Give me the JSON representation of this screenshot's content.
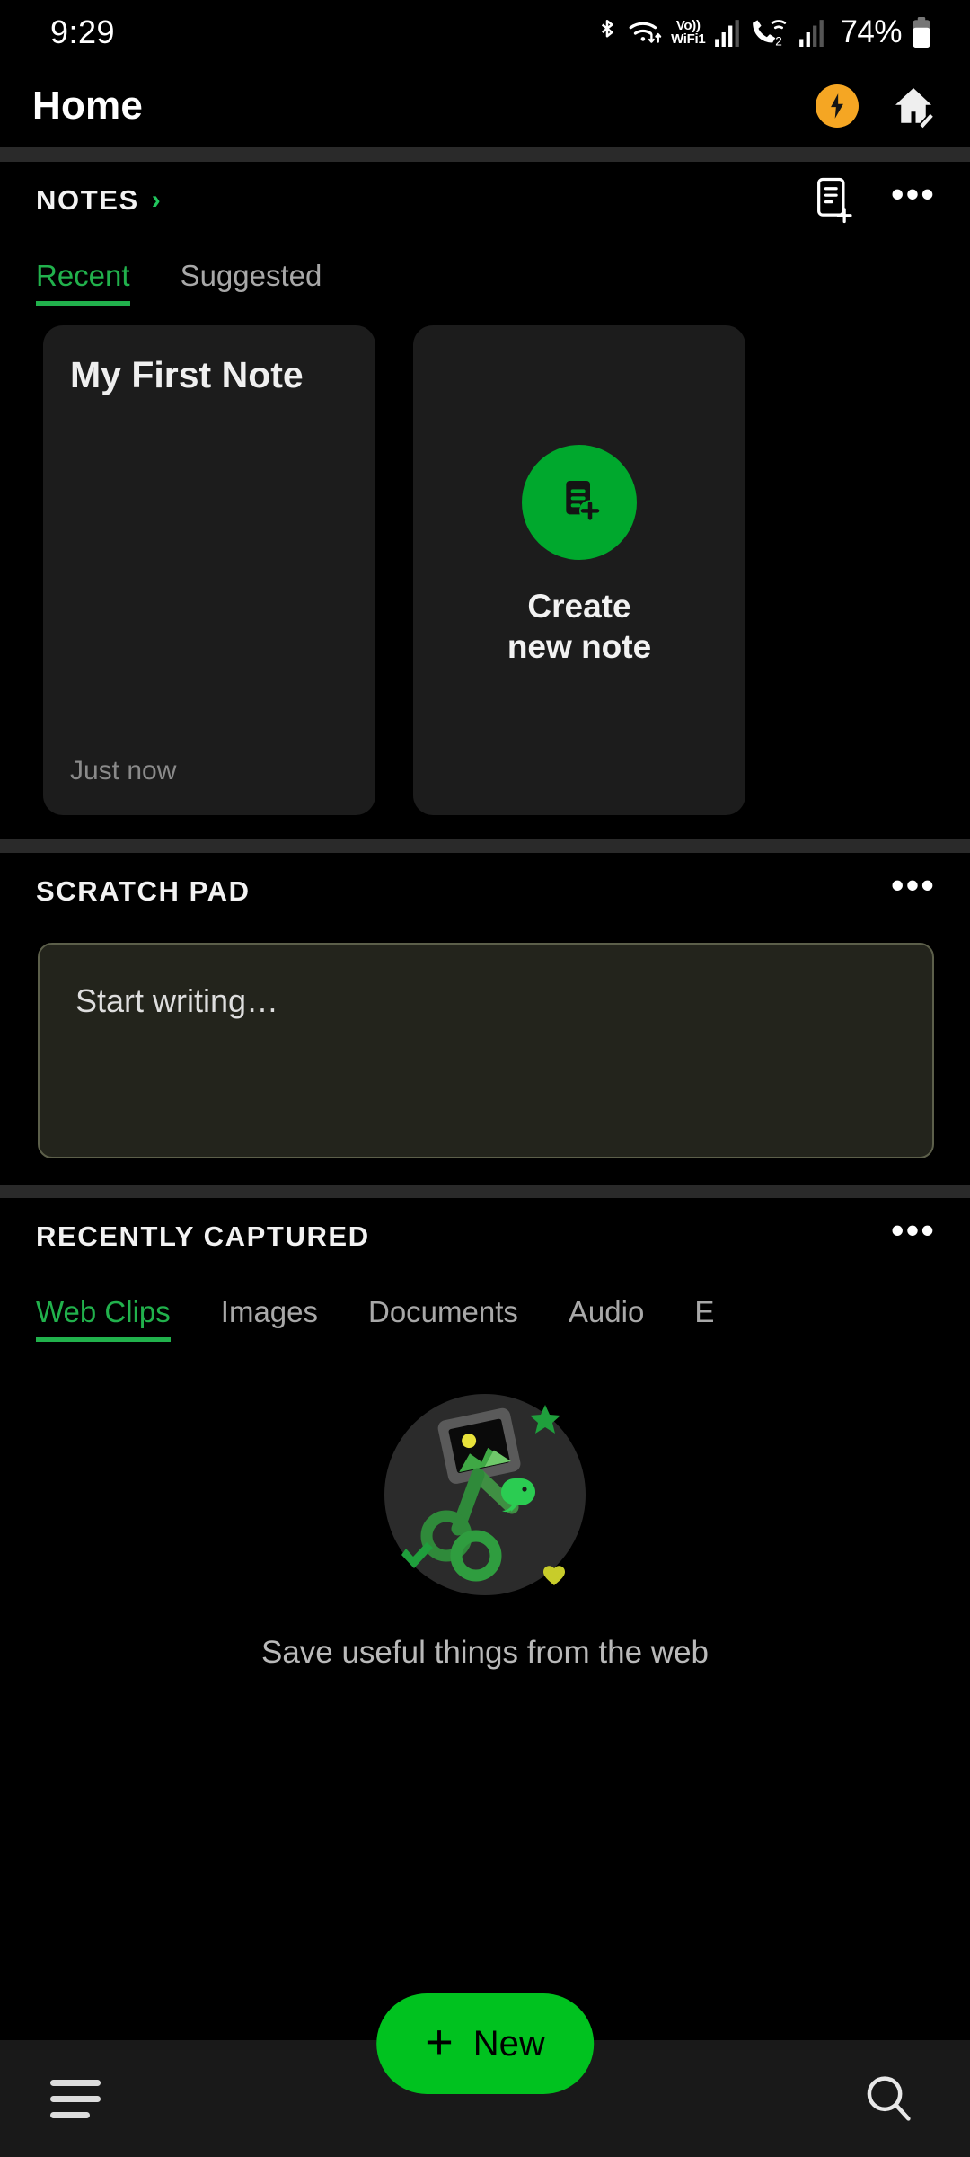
{
  "status_bar": {
    "time": "9:29",
    "battery_percent": "74%",
    "volte_line1": "Vo))",
    "volte_line2": "WiFi1",
    "icons": [
      "bluetooth-icon",
      "wifi-icon",
      "volte-wifi-icon",
      "signal-bars-icon",
      "call-wifi-2-icon",
      "signal-bars-2-icon",
      "battery-icon"
    ]
  },
  "app_bar": {
    "title": "Home",
    "flash_icon": "lightning-bolt-icon",
    "home_icon": "home-edit-icon"
  },
  "notes_section": {
    "title": "NOTES",
    "chevron": "›",
    "new_note_icon": "note-add-icon",
    "overflow_icon": "more-options-icon",
    "tabs": [
      {
        "label": "Recent",
        "active": true
      },
      {
        "label": "Suggested",
        "active": false
      }
    ],
    "cards": [
      {
        "title": "My First Note",
        "timestamp": "Just now"
      }
    ],
    "create_card": {
      "line1": "Create",
      "line2": "new note",
      "icon": "create-note-icon"
    }
  },
  "scratch_pad": {
    "title": "SCRATCH PAD",
    "overflow_icon": "more-options-icon",
    "placeholder": "Start writing…"
  },
  "recently_captured": {
    "title": "RECENTLY CAPTURED",
    "overflow_icon": "more-options-icon",
    "tabs": [
      {
        "label": "Web Clips",
        "active": true
      },
      {
        "label": "Images",
        "active": false
      },
      {
        "label": "Documents",
        "active": false
      },
      {
        "label": "Audio",
        "active": false
      },
      {
        "label": "E",
        "active": false
      }
    ],
    "empty_state": {
      "illustration": "web-clipper-illustration",
      "text": "Save useful things from the web"
    }
  },
  "bottom_bar": {
    "fab_plus": "+",
    "fab_label": "New",
    "menu_icon": "hamburger-menu-icon",
    "search_icon": "search-icon"
  },
  "colors": {
    "brand_green": "#00A82D",
    "accent_green": "#21b14c",
    "fab_green": "#00C21F",
    "amber": "#F5A623",
    "background": "#000000",
    "card": "#1c1c1c",
    "scratch_bg": "#23241c"
  }
}
